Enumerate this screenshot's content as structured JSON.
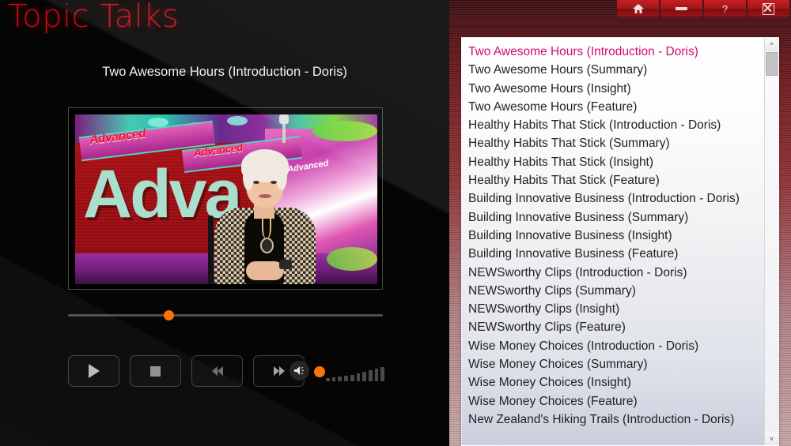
{
  "app": {
    "title": "Topic Talks"
  },
  "titlebar": {
    "buttons": [
      {
        "name": "home",
        "glyph": "home-icon",
        "label": ""
      },
      {
        "name": "minimize",
        "glyph": "minimize-icon",
        "label": ""
      },
      {
        "name": "help",
        "glyph": "help-icon",
        "label": "?"
      },
      {
        "name": "close",
        "glyph": "close-icon",
        "label": ""
      }
    ]
  },
  "player": {
    "now_playing_title": "Two Awesome Hours (Introduction - Doris)",
    "video_caption_banner_1": "Advanced",
    "video_caption_banner_2": "Advanced",
    "video_caption_banner_3": "Advanced",
    "video_backdrop_word": "Adva",
    "seek_position_percent": 32,
    "volume_percent": 6,
    "controls": [
      {
        "name": "play",
        "label": "Play"
      },
      {
        "name": "stop",
        "label": "Stop"
      },
      {
        "name": "rewind",
        "label": "Rewind"
      },
      {
        "name": "fast-forward",
        "label": "Fast Forward"
      }
    ],
    "volume_icon": "speaker-icon"
  },
  "playlist": {
    "selected_index": 0,
    "items": [
      "Two Awesome Hours (Introduction - Doris)",
      "Two Awesome Hours (Summary)",
      "Two Awesome Hours (Insight)",
      "Two Awesome Hours (Feature)",
      "Healthy Habits That Stick (Introduction - Doris)",
      "Healthy Habits That Stick (Summary)",
      "Healthy Habits That Stick (Insight)",
      "Healthy Habits That Stick (Feature)",
      "Building Innovative Business (Introduction - Doris)",
      "Building Innovative Business (Summary)",
      "Building Innovative Business (Insight)",
      "Building Innovative Business (Feature)",
      "NEWSworthy Clips (Introduction - Doris)",
      "NEWSworthy Clips (Summary)",
      "NEWSworthy Clips (Insight)",
      "NEWSworthy Clips (Feature)",
      "Wise Money Choices (Introduction - Doris)",
      "Wise Money Choices (Summary)",
      "Wise Money Choices (Insight)",
      "Wise Money Choices (Feature)",
      "New Zealand's Hiking Trails (Introduction - Doris)"
    ],
    "scrollbar": {
      "up_arrow": "^",
      "down_arrow": "˅"
    }
  },
  "colors": {
    "brand_red": "#c00c12",
    "panel_red": "#8f3337",
    "accent_orange": "#f97306",
    "selected_item": "#cf0b6b"
  }
}
